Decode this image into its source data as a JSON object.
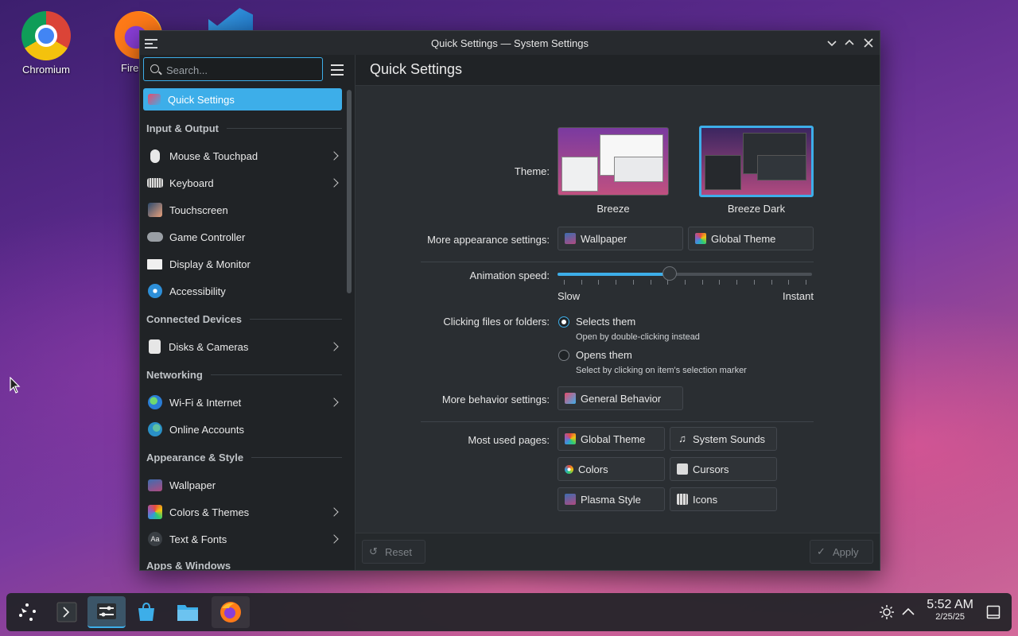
{
  "desktop": {
    "icons": [
      {
        "label": "Chromium"
      },
      {
        "label": "Fire"
      },
      {
        "label": ""
      }
    ]
  },
  "window": {
    "title": "Quick Settings — System Settings"
  },
  "sidebar": {
    "search_placeholder": "Search...",
    "active": "Quick Settings",
    "sections": {
      "input_output": "Input & Output",
      "connected_devices": "Connected Devices",
      "networking": "Networking",
      "appearance": "Appearance & Style",
      "apps_windows": "Apps & Windows"
    },
    "items": {
      "mouse": "Mouse & Touchpad",
      "keyboard": "Keyboard",
      "touchscreen": "Touchscreen",
      "game": "Game Controller",
      "display": "Display & Monitor",
      "accessibility": "Accessibility",
      "disks": "Disks & Cameras",
      "wifi": "Wi-Fi & Internet",
      "online": "Online Accounts",
      "wallpaper": "Wallpaper",
      "colors": "Colors & Themes",
      "text": "Text & Fonts"
    }
  },
  "main": {
    "page_title": "Quick Settings",
    "theme_label": "Theme:",
    "themes": [
      {
        "name": "Breeze",
        "selected": false
      },
      {
        "name": "Breeze Dark",
        "selected": true
      }
    ],
    "more_appearance_label": "More appearance settings:",
    "wallpaper_btn": "Wallpaper",
    "global_theme_btn": "Global Theme",
    "animation_label": "Animation speed:",
    "animation_value": 0.44,
    "slow": "Slow",
    "instant": "Instant",
    "clicking_label": "Clicking files or folders:",
    "opt_select": "Selects them",
    "opt_select_hint": "Open by double-clicking instead",
    "opt_open": "Opens them",
    "opt_open_hint": "Select by clicking on item's selection marker",
    "clicking_selected": "Selects them",
    "more_behavior_label": "More behavior settings:",
    "general_behavior_btn": "General Behavior",
    "most_used_label": "Most used pages:",
    "most_used": {
      "global_theme": "Global Theme",
      "system_sounds": "System Sounds",
      "colors": "Colors",
      "cursors": "Cursors",
      "plasma_style": "Plasma Style",
      "icons": "Icons"
    },
    "reset": "Reset",
    "apply": "Apply"
  },
  "taskbar": {
    "time": "5:52 AM",
    "date": "2/25/25"
  },
  "colors": {
    "accent": "#3daee9",
    "window_bg": "#202326",
    "panel_bg": "#2a2e32"
  }
}
